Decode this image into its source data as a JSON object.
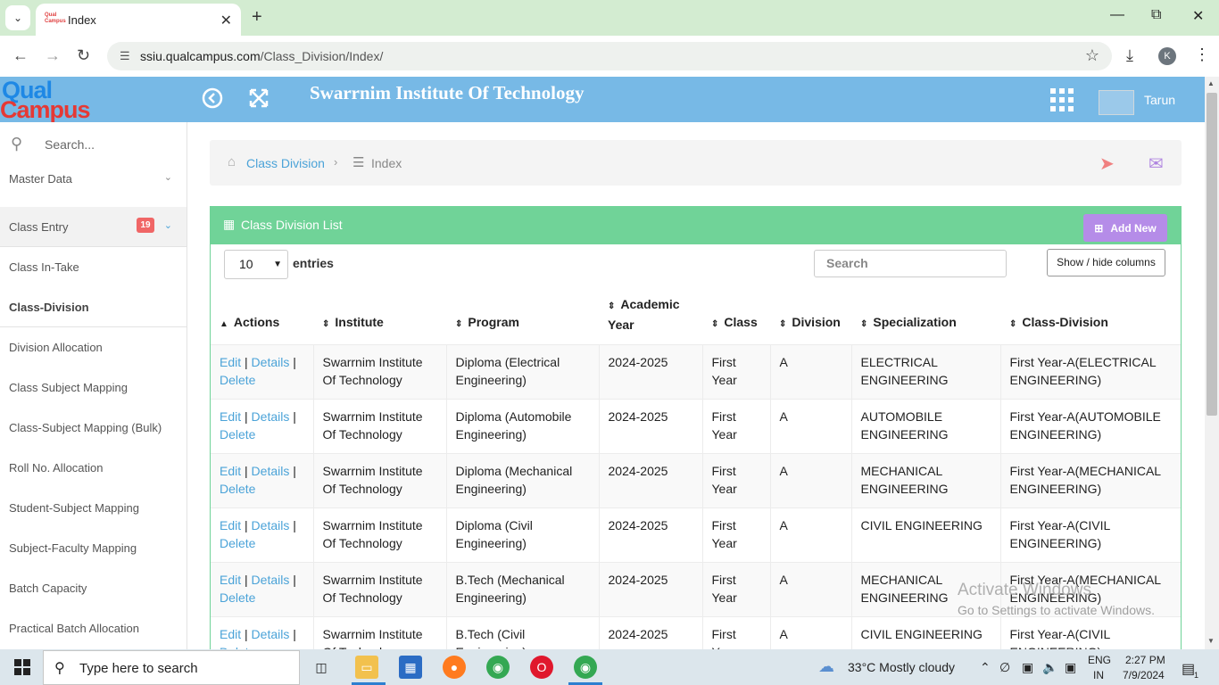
{
  "browser": {
    "tab_title": "Index",
    "favicon_text": "Qual Campus",
    "url_host": "ssiu.qualcampus.com",
    "url_path": "/Class_Division/Index/",
    "profile_initial": "K"
  },
  "header": {
    "logo_top": "Qual",
    "logo_bottom": "Campus",
    "institute_title": "Swarrnim Institute Of Technology",
    "user_name": "Tarun"
  },
  "sidebar": {
    "search_placeholder": "Search...",
    "items": [
      {
        "label": "Master Data"
      },
      {
        "label": "Class Entry",
        "badge": "19"
      },
      {
        "label": "Class In-Take"
      },
      {
        "label": "Class-Division"
      },
      {
        "label": "Division Allocation"
      },
      {
        "label": "Class Subject Mapping"
      },
      {
        "label": "Class-Subject Mapping (Bulk)"
      },
      {
        "label": "Roll No. Allocation"
      },
      {
        "label": "Student-Subject Mapping"
      },
      {
        "label": "Subject-Faculty Mapping"
      },
      {
        "label": "Batch Capacity"
      },
      {
        "label": "Practical Batch Allocation"
      }
    ]
  },
  "breadcrumb": {
    "link": "Class Division",
    "current": "Index"
  },
  "panel": {
    "title": "Class Division List",
    "add_new": "Add New",
    "page_length": "10",
    "entries_label": "entries",
    "search_placeholder": "Search",
    "col_toggle": "Show / hide columns"
  },
  "table": {
    "headers": [
      "Actions",
      "Institute",
      "Program",
      "Academic Year",
      "Class",
      "Division",
      "Specialization",
      "Class-Division"
    ],
    "action_edit": "Edit",
    "action_details": "Details",
    "action_delete": "Delete",
    "rows": [
      {
        "institute": "Swarrnim Institute Of Technology",
        "program": "Diploma (Electrical Engineering)",
        "year": "2024-2025",
        "class": "First Year",
        "division": "A",
        "specialization": "ELECTRICAL ENGINEERING",
        "class_division": "First Year-A(ELECTRICAL ENGINEERING)"
      },
      {
        "institute": "Swarrnim Institute Of Technology",
        "program": "Diploma (Automobile Engineering)",
        "year": "2024-2025",
        "class": "First Year",
        "division": "A",
        "specialization": "AUTOMOBILE ENGINEERING",
        "class_division": "First Year-A(AUTOMOBILE ENGINEERING)"
      },
      {
        "institute": "Swarrnim Institute Of Technology",
        "program": "Diploma (Mechanical Engineering)",
        "year": "2024-2025",
        "class": "First Year",
        "division": "A",
        "specialization": "MECHANICAL ENGINEERING",
        "class_division": "First Year-A(MECHANICAL ENGINEERING)"
      },
      {
        "institute": "Swarrnim Institute Of Technology",
        "program": "Diploma (Civil Engineering)",
        "year": "2024-2025",
        "class": "First Year",
        "division": "A",
        "specialization": "CIVIL ENGINEERING",
        "class_division": "First Year-A(CIVIL ENGINEERING)"
      },
      {
        "institute": "Swarrnim Institute Of Technology",
        "program": "B.Tech (Mechanical Engineering)",
        "year": "2024-2025",
        "class": "First Year",
        "division": "A",
        "specialization": "MECHANICAL ENGINEERING",
        "class_division": "First Year-A(MECHANICAL ENGINEERING)"
      },
      {
        "institute": "Swarrnim Institute Of Technology",
        "program": "B.Tech (Civil Engineering)",
        "year": "2024-2025",
        "class": "First Year",
        "division": "A",
        "specialization": "CIVIL ENGINEERING",
        "class_division": "First Year-A(CIVIL ENGINEERING)"
      }
    ]
  },
  "watermark": {
    "line1": "Activate Windows",
    "line2": "Go to Settings to activate Windows."
  },
  "taskbar": {
    "search_text": "Type here to search",
    "weather": "33°C  Mostly cloudy",
    "lang_top": "ENG",
    "lang_bottom": "IN",
    "time": "2:27 PM",
    "date": "7/9/2024",
    "notif_count": "1"
  }
}
